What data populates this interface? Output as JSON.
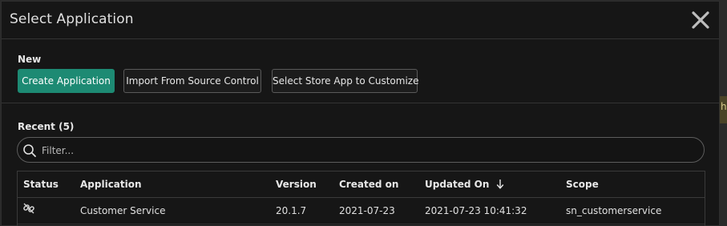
{
  "backdrop": {
    "peek_text": "h"
  },
  "dialog": {
    "title": "Select Application",
    "close_icon": "close-icon"
  },
  "new_section": {
    "label": "New",
    "buttons": [
      "Create Application",
      "Import From Source Control",
      "Select Store App to Customize"
    ]
  },
  "recent_section": {
    "label": "Recent (5)",
    "filter_placeholder": "Filter...",
    "columns": [
      "Status",
      "Application",
      "Version",
      "Created on",
      "Updated On",
      "Scope"
    ],
    "sort_indicator": "arrow-down-icon",
    "rows": [
      {
        "status_icon": "link-broken-icon",
        "application": "Customer Service",
        "version": "20.1.7",
        "created_on": "2021-07-23",
        "updated_on": "2021-07-23 10:41:32",
        "scope": "sn_customerservice"
      }
    ]
  },
  "colors": {
    "primary": "#1d8a73",
    "background": "#161616",
    "border": "#3a3a3a"
  }
}
